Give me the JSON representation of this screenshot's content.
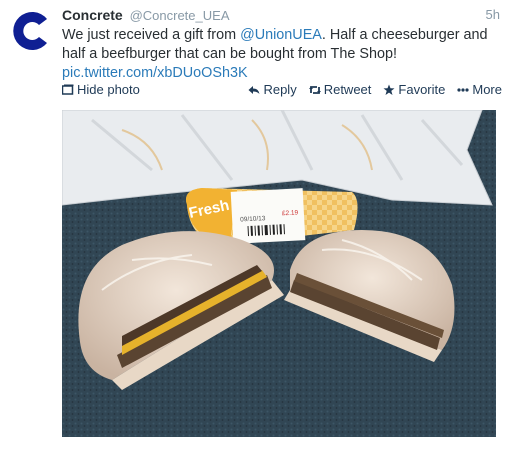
{
  "tweet": {
    "name": "Concrete",
    "handle": "@Concrete_UEA",
    "time": "5h",
    "text_before": "We just received a gift from ",
    "mention": "@UnionUEA",
    "text_after": ". Half a cheeseburger and half a beefburger that can be bought from The Shop!",
    "link": "pic.twitter.com/xbDUoOSh3K"
  },
  "actions": {
    "hide_photo": "Hide photo",
    "reply": "Reply",
    "retweet": "Retweet",
    "favorite": "Favorite",
    "more": "More"
  },
  "photo": {
    "package_word": "Fresh",
    "label_date": "09/10/13",
    "label_price": "£2.19"
  },
  "colors": {
    "avatar": "#0f1f93",
    "link": "#2b7bb9",
    "action": "#1f3a56"
  }
}
